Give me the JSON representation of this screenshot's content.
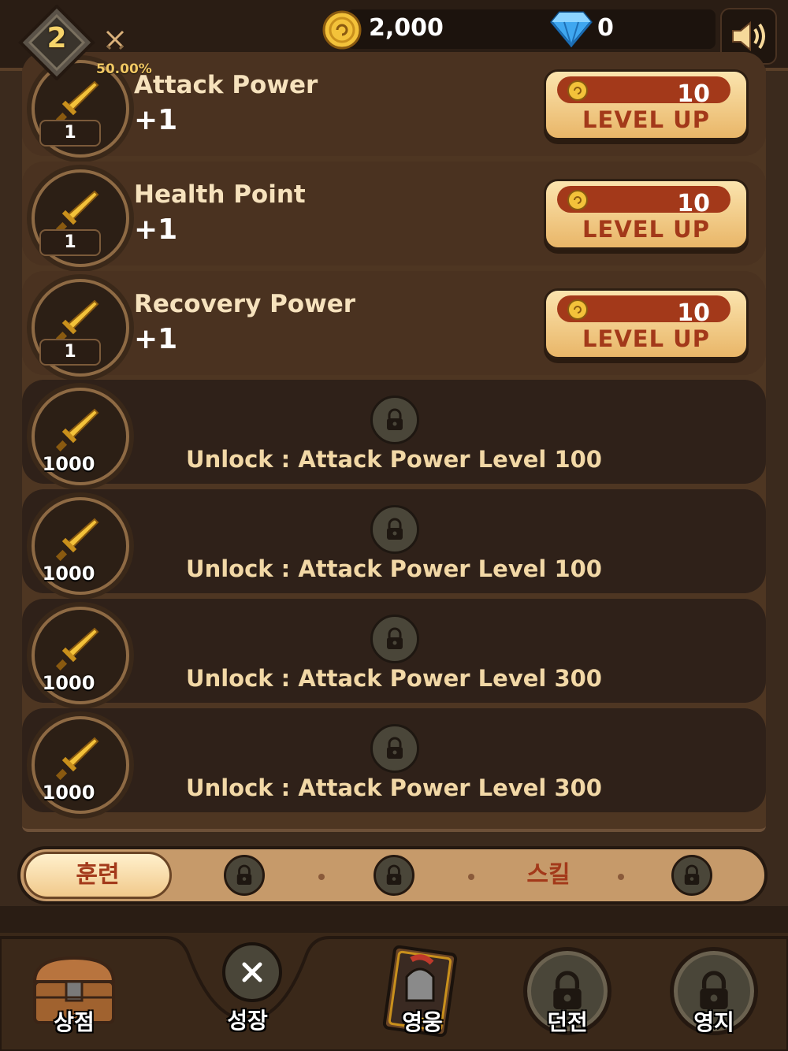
{
  "player": {
    "level": "2",
    "xp_percent": "50.00%",
    "xp_fraction": 0.5
  },
  "currency": {
    "gold": "2,000",
    "gems": "0"
  },
  "upgrades": [
    {
      "title": "Attack Power",
      "value": "+1",
      "level": "1",
      "cost": "10",
      "button": "LEVEL UP"
    },
    {
      "title": "Health Point",
      "value": "+1",
      "level": "1",
      "cost": "10",
      "button": "LEVEL UP"
    },
    {
      "title": "Recovery Power",
      "value": "+1",
      "level": "1",
      "cost": "10",
      "button": "LEVEL UP"
    }
  ],
  "locked": [
    {
      "level": "1000",
      "text": "Unlock : Attack Power Level 100"
    },
    {
      "level": "1000",
      "text": "Unlock : Attack Power Level 100"
    },
    {
      "level": "1000",
      "text": "Unlock : Attack Power Level 300"
    },
    {
      "level": "1000",
      "text": "Unlock : Attack Power Level 300"
    }
  ],
  "tabs": {
    "active": "훈련",
    "skill": "스킬"
  },
  "nav": {
    "shop": "상점",
    "growth": "성장",
    "hero": "영웅",
    "dungeon": "던전",
    "territory": "영지"
  },
  "colors": {
    "accent": "#a3391a",
    "gold": "#f0b447",
    "panel": "#4e3622"
  }
}
